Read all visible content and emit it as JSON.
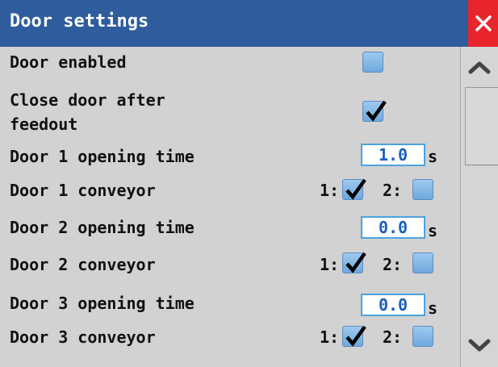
{
  "window": {
    "title": "Door settings",
    "colors": {
      "titlebar": "#2e5c9c",
      "close": "#e8252c",
      "field_text": "#1a5fbf",
      "checkbox": "#6fa8de"
    }
  },
  "rows": {
    "door_enabled": {
      "label": "Door enabled",
      "checked": false
    },
    "close_after_feedout": {
      "label_line1": "Close door after",
      "label_line2": "feedout",
      "checked": true
    },
    "door1_opening": {
      "label": "Door 1 opening time",
      "value": "1.0",
      "unit": "s"
    },
    "door1_conveyor": {
      "label": "Door 1 conveyor",
      "opt1": "1:",
      "opt1_checked": true,
      "opt2": "2:",
      "opt2_checked": false
    },
    "door2_opening": {
      "label": "Door 2 opening time",
      "value": "0.0",
      "unit": "s"
    },
    "door2_conveyor": {
      "label": "Door 2 conveyor",
      "opt1": "1:",
      "opt1_checked": true,
      "opt2": "2:",
      "opt2_checked": false
    },
    "door3_opening": {
      "label": "Door 3 opening time",
      "value": "0.0",
      "unit": "s"
    },
    "door3_conveyor": {
      "label": "Door 3 conveyor",
      "opt1": "1:",
      "opt1_checked": true,
      "opt2": "2:",
      "opt2_checked": false
    }
  },
  "icons": {
    "close": "close-icon",
    "up": "chevron-up-icon",
    "down": "chevron-down-icon",
    "check": "checkmark-icon"
  }
}
